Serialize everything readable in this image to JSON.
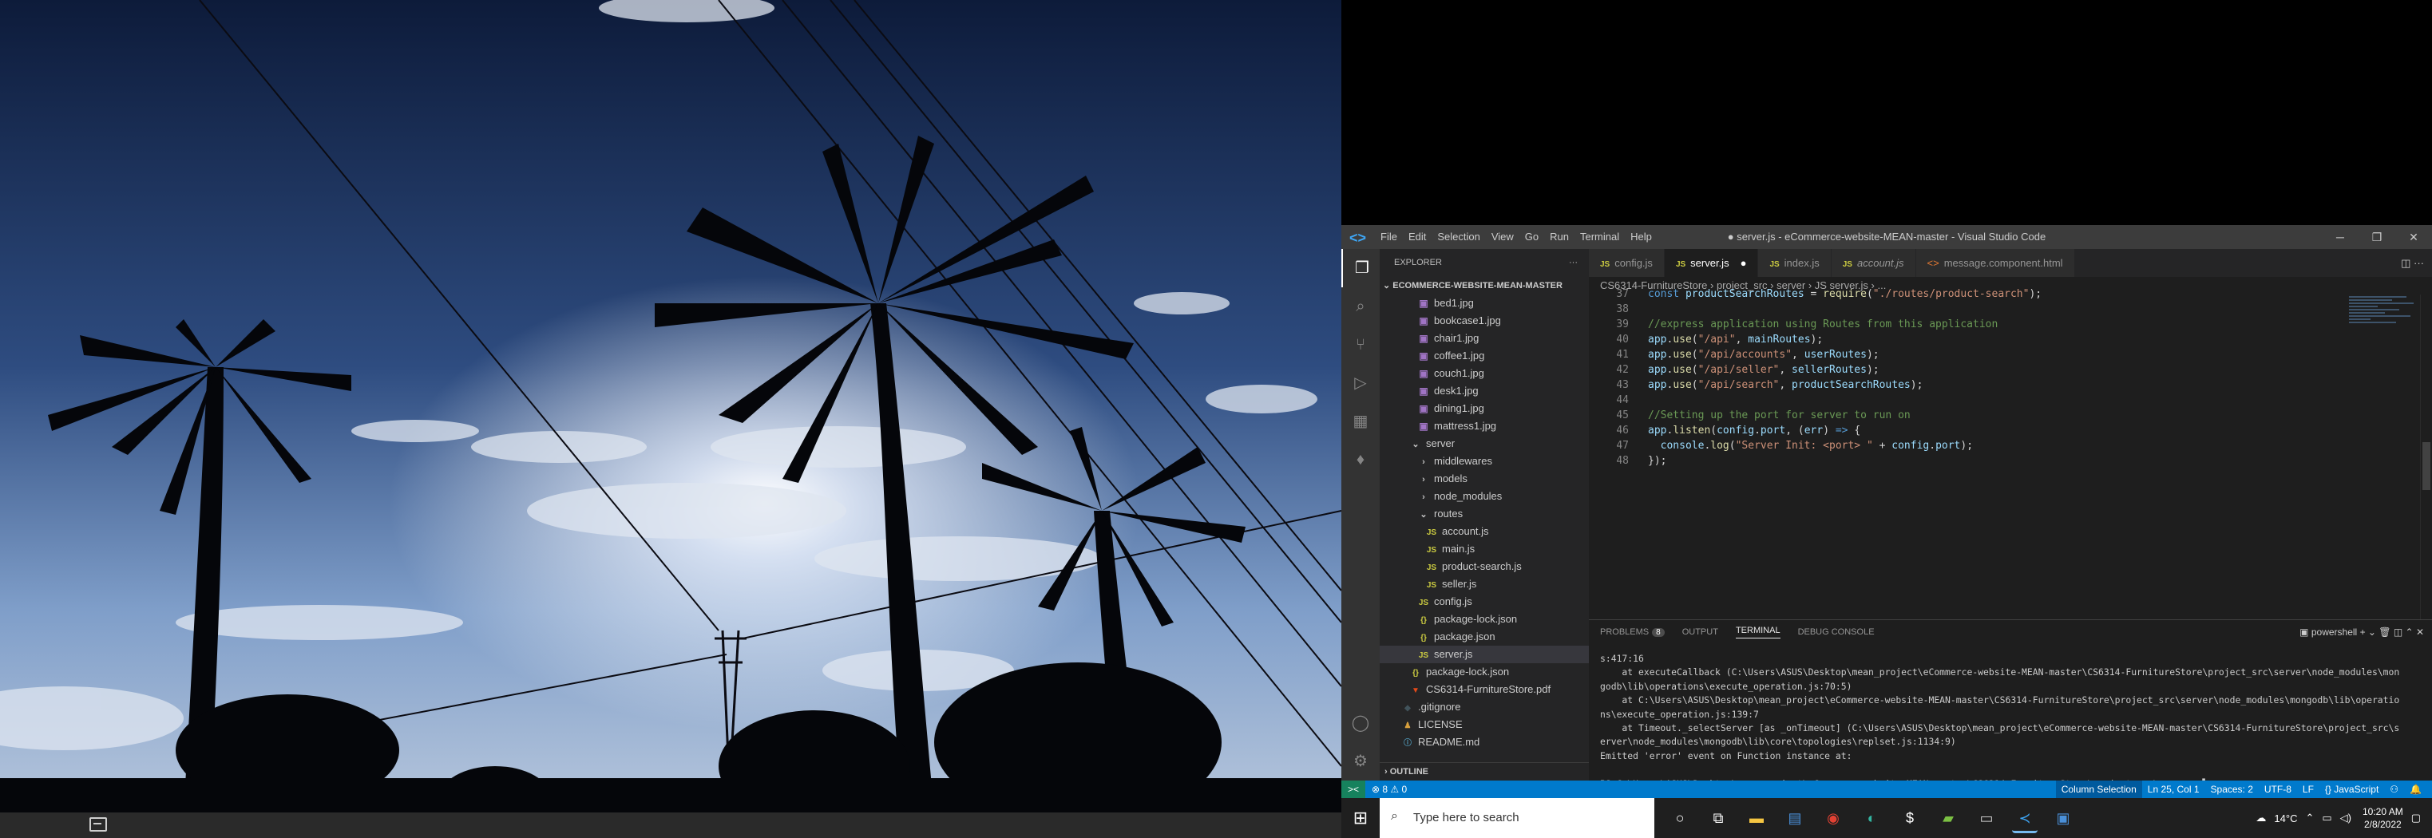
{
  "vscode": {
    "window_title": "● server.js - eCommerce-website-MEAN-master - Visual Studio Code",
    "menu": [
      "File",
      "Edit",
      "Selection",
      "View",
      "Go",
      "Run",
      "Terminal",
      "Help"
    ],
    "window_controls": [
      "─",
      "❐",
      "✕"
    ],
    "sidebar": {
      "header": "EXPLORER",
      "project": "ECOMMERCE-WEBSITE-MEAN-MASTER",
      "items": [
        {
          "label": "bed1.jpg",
          "kind": "img",
          "indent": 1
        },
        {
          "label": "bookcase1.jpg",
          "kind": "img",
          "indent": 1
        },
        {
          "label": "chair1.jpg",
          "kind": "img",
          "indent": 1
        },
        {
          "label": "coffee1.jpg",
          "kind": "img",
          "indent": 1
        },
        {
          "label": "couch1.jpg",
          "kind": "img",
          "indent": 1
        },
        {
          "label": "desk1.jpg",
          "kind": "img",
          "indent": 1
        },
        {
          "label": "dining1.jpg",
          "kind": "img",
          "indent": 1
        },
        {
          "label": "mattress1.jpg",
          "kind": "img",
          "indent": 1
        },
        {
          "label": "server",
          "kind": "folder-open",
          "indent": 0
        },
        {
          "label": "middlewares",
          "kind": "folder",
          "indent": 1
        },
        {
          "label": "models",
          "kind": "folder",
          "indent": 1
        },
        {
          "label": "node_modules",
          "kind": "folder",
          "indent": 1
        },
        {
          "label": "routes",
          "kind": "folder-open",
          "indent": 1
        },
        {
          "label": "account.js",
          "kind": "js",
          "indent": 2
        },
        {
          "label": "main.js",
          "kind": "js",
          "indent": 2
        },
        {
          "label": "product-search.js",
          "kind": "js",
          "indent": 2
        },
        {
          "label": "seller.js",
          "kind": "js",
          "indent": 2
        },
        {
          "label": "config.js",
          "kind": "js",
          "indent": 1
        },
        {
          "label": "package-lock.json",
          "kind": "json",
          "indent": 1
        },
        {
          "label": "package.json",
          "kind": "json",
          "indent": 1
        },
        {
          "label": "server.js",
          "kind": "js",
          "indent": 1,
          "selected": true
        },
        {
          "label": "package-lock.json",
          "kind": "json",
          "indent": 0
        },
        {
          "label": "CS6314-FurnitureStore.pdf",
          "kind": "pdf",
          "indent": 0
        },
        {
          "label": ".gitignore",
          "kind": "git",
          "indent": -1
        },
        {
          "label": "LICENSE",
          "kind": "lic",
          "indent": -1
        },
        {
          "label": "README.md",
          "kind": "info",
          "indent": -1
        }
      ],
      "outline": "OUTLINE"
    },
    "tabs": [
      {
        "label": "config.js",
        "kind": "js",
        "active": false
      },
      {
        "label": "server.js",
        "kind": "js",
        "active": true,
        "dirty": true
      },
      {
        "label": "index.js",
        "kind": "js",
        "active": false
      },
      {
        "label": "account.js",
        "kind": "js",
        "active": false
      },
      {
        "label": "message.component.html",
        "kind": "html",
        "active": false
      }
    ],
    "breadcrumb": "CS6314-FurnitureStore › project_src › server › JS server.js › ...",
    "code_lines": [
      {
        "n": "37",
        "parts": [
          [
            "kw",
            "const "
          ],
          [
            "var",
            "productSearchRoutes"
          ],
          [
            "p",
            " = "
          ],
          [
            "fn",
            "require"
          ],
          [
            "p",
            "("
          ],
          [
            "str",
            "\"./routes/product-search\""
          ],
          [
            "p",
            ");"
          ]
        ]
      },
      {
        "n": "38",
        "parts": []
      },
      {
        "n": "39",
        "parts": [
          [
            "com",
            "//express application using Routes from this application"
          ]
        ]
      },
      {
        "n": "40",
        "parts": [
          [
            "var",
            "app"
          ],
          [
            "p",
            "."
          ],
          [
            "fn",
            "use"
          ],
          [
            "p",
            "("
          ],
          [
            "str",
            "\"/api\""
          ],
          [
            "p",
            ", "
          ],
          [
            "var",
            "mainRoutes"
          ],
          [
            "p",
            ");"
          ]
        ]
      },
      {
        "n": "41",
        "parts": [
          [
            "var",
            "app"
          ],
          [
            "p",
            "."
          ],
          [
            "fn",
            "use"
          ],
          [
            "p",
            "("
          ],
          [
            "str",
            "\"/api/accounts\""
          ],
          [
            "p",
            ", "
          ],
          [
            "var",
            "userRoutes"
          ],
          [
            "p",
            ");"
          ]
        ]
      },
      {
        "n": "42",
        "parts": [
          [
            "var",
            "app"
          ],
          [
            "p",
            "."
          ],
          [
            "fn",
            "use"
          ],
          [
            "p",
            "("
          ],
          [
            "str",
            "\"/api/seller\""
          ],
          [
            "p",
            ", "
          ],
          [
            "var",
            "sellerRoutes"
          ],
          [
            "p",
            ");"
          ]
        ]
      },
      {
        "n": "43",
        "parts": [
          [
            "var",
            "app"
          ],
          [
            "p",
            "."
          ],
          [
            "fn",
            "use"
          ],
          [
            "p",
            "("
          ],
          [
            "str",
            "\"/api/search\""
          ],
          [
            "p",
            ", "
          ],
          [
            "var",
            "productSearchRoutes"
          ],
          [
            "p",
            ");"
          ]
        ]
      },
      {
        "n": "44",
        "parts": []
      },
      {
        "n": "45",
        "parts": [
          [
            "com",
            "//Setting up the port for server to run on"
          ]
        ]
      },
      {
        "n": "46",
        "parts": [
          [
            "var",
            "app"
          ],
          [
            "p",
            "."
          ],
          [
            "fn",
            "listen"
          ],
          [
            "p",
            "("
          ],
          [
            "var",
            "config"
          ],
          [
            "p",
            "."
          ],
          [
            "var",
            "port"
          ],
          [
            "p",
            ", ("
          ],
          [
            "var",
            "err"
          ],
          [
            "p",
            ") "
          ],
          [
            "kw",
            "=>"
          ],
          [
            "p",
            " {"
          ]
        ]
      },
      {
        "n": "47",
        "parts": [
          [
            "p",
            "  "
          ],
          [
            "var",
            "console"
          ],
          [
            "p",
            "."
          ],
          [
            "fn",
            "log"
          ],
          [
            "p",
            "("
          ],
          [
            "str",
            "\"Server Init: <port> \""
          ],
          [
            "p",
            " + "
          ],
          [
            "var",
            "config"
          ],
          [
            "p",
            "."
          ],
          [
            "var",
            "port"
          ],
          [
            "p",
            ");"
          ]
        ]
      },
      {
        "n": "48",
        "parts": [
          [
            "p",
            "});"
          ]
        ]
      }
    ],
    "panel": {
      "tabs": [
        {
          "label": "PROBLEMS",
          "badge": "8"
        },
        {
          "label": "OUTPUT"
        },
        {
          "label": "TERMINAL",
          "active": true
        },
        {
          "label": "DEBUG CONSOLE"
        }
      ],
      "shell": "powershell",
      "terminal_lines": [
        "s:417:16",
        "    at executeCallback (C:\\Users\\ASUS\\Desktop\\mean_project\\eCommerce-website-MEAN-master\\CS6314-FurnitureStore\\project_src\\server\\node_modules\\mon",
        "godb\\lib\\operations\\execute_operation.js:70:5)",
        "    at C:\\Users\\ASUS\\Desktop\\mean_project\\eCommerce-website-MEAN-master\\CS6314-FurnitureStore\\project_src\\server\\node_modules\\mongodb\\lib\\operatio",
        "ns\\execute_operation.js:139:7",
        "    at Timeout._selectServer [as _onTimeout] (C:\\Users\\ASUS\\Desktop\\mean_project\\eCommerce-website-MEAN-master\\CS6314-FurnitureStore\\project_src\\s",
        "erver\\node_modules\\mongodb\\lib\\core\\topologies\\replset.js:1134:9)",
        "Emitted 'error' event on Function instance at:",
        "",
        "PS C:\\Users\\ASUS\\Desktop\\mean_project\\eCommerce-website-MEAN-master\\CS6314-FurnitureStore\\project_src\\server> ▌"
      ]
    },
    "statusbar": {
      "remote": "><",
      "problems": "⊗ 8 ⚠ 0",
      "right": [
        "Column Selection",
        "Ln 25, Col 1",
        "Spaces: 2",
        "UTF-8",
        "LF",
        "{} JavaScript",
        "⚇",
        "🔔"
      ]
    }
  },
  "taskbar": {
    "search_placeholder": "Type here to search",
    "apps": [
      "cortana",
      "task-view",
      "file-explorer",
      "notepad",
      "chrome",
      "edge",
      "app-dollar",
      "app-green",
      "terminal",
      "vscode",
      "app-blue"
    ],
    "weather": "14°C",
    "time": "10:20 AM",
    "date": "2/8/2022"
  },
  "colors": {
    "accent": "#007acc",
    "titlebar": "#3c3c3c",
    "sidebar": "#252526",
    "editor": "#1e1e1e",
    "taskbar": "#1f1f1f"
  }
}
